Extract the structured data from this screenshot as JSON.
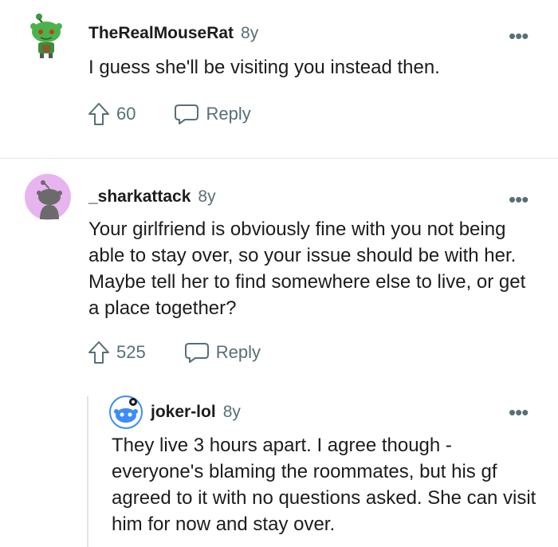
{
  "comments": [
    {
      "username": "TheRealMouseRat",
      "age": "8y",
      "text": "I guess she'll be visiting you instead then.",
      "votes": "60",
      "reply_label": "Reply",
      "more_label": "•••"
    },
    {
      "username": "_sharkattack",
      "age": "8y",
      "text": "Your girlfriend is obviously fine with you not being able to stay over, so your issue should be with her. Maybe tell her to find somewhere else to live, or get a place together?",
      "votes": "525",
      "reply_label": "Reply",
      "more_label": "•••"
    },
    {
      "username": "joker-lol",
      "age": "8y",
      "text": "They live 3 hours apart. I agree though - everyone's blaming the roommates, but his gf agreed to it with no questions asked. She can visit him for now and stay over.",
      "more_label": "•••"
    }
  ],
  "colors": {
    "meta_gray": "#576f76",
    "text": "#1c1c1c",
    "divider": "#e3e6e8",
    "avatar_green": "#4bb34b",
    "avatar_purple_bg": "#e8b4f0",
    "avatar_blue": "#3d8df5"
  }
}
